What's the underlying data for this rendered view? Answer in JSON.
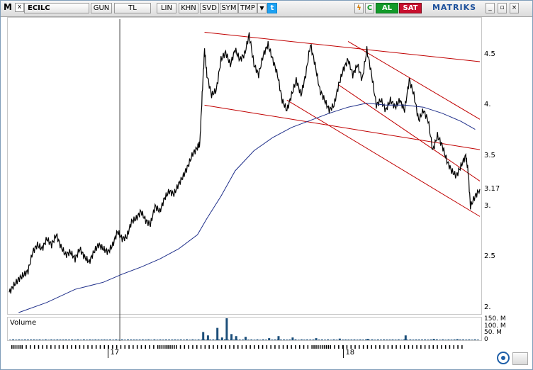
{
  "toolbar": {
    "logo": "M",
    "close_glyph": "x",
    "symbol": "ECILC",
    "period": "GUN",
    "currency": "TL",
    "scale": "LIN",
    "buttons": [
      "KHN",
      "SVD",
      "SYM",
      "TMP"
    ],
    "dropdown_glyph": "▼",
    "twitter_glyph": "t",
    "bolt_glyph": "ϟ",
    "refresh_glyph": "C",
    "buy_label": "AL",
    "sell_label": "SAT",
    "brand": "MATRIKS",
    "window_controls": [
      "_",
      "▫",
      "×"
    ]
  },
  "price_axis": {
    "ticks": [
      {
        "value": 4.5,
        "label": "4.5"
      },
      {
        "value": 4.0,
        "label": "4."
      },
      {
        "value": 3.5,
        "label": "3.5"
      },
      {
        "value": 3.17,
        "label": "3.17"
      },
      {
        "value": 3.0,
        "label": "3."
      },
      {
        "value": 2.5,
        "label": "2.5"
      },
      {
        "value": 2.0,
        "label": "2."
      }
    ],
    "last_price": 3.17
  },
  "volume_panel": {
    "title": "Volume",
    "ticks": [
      "150. M",
      "100. M",
      "50. M",
      "0"
    ]
  },
  "time_axis": {
    "labels": [
      "17",
      "18"
    ]
  },
  "colors": {
    "price_line": "#000000",
    "moving_average": "#1f2f8a",
    "trend_lines": "#c00000",
    "volume_bars": "#1d4f7a",
    "buy": "#139a2a",
    "sell": "#c8102e"
  },
  "chart_data": {
    "type": "line",
    "symbol": "ECILC",
    "ylim": [
      1.95,
      4.85
    ],
    "x_range": [
      0,
      1
    ],
    "series": [
      {
        "name": "",
        "values": [
          [
            0.0,
            2.15
          ],
          [
            0.01,
            2.22
          ],
          [
            0.02,
            2.28
          ],
          [
            0.03,
            2.32
          ],
          [
            0.04,
            2.36
          ],
          [
            0.05,
            2.55
          ],
          [
            0.06,
            2.62
          ],
          [
            0.07,
            2.58
          ],
          [
            0.08,
            2.68
          ],
          [
            0.09,
            2.62
          ],
          [
            0.1,
            2.72
          ],
          [
            0.11,
            2.6
          ],
          [
            0.12,
            2.52
          ],
          [
            0.13,
            2.55
          ],
          [
            0.14,
            2.48
          ],
          [
            0.15,
            2.58
          ],
          [
            0.16,
            2.5
          ],
          [
            0.17,
            2.45
          ],
          [
            0.18,
            2.55
          ],
          [
            0.19,
            2.62
          ],
          [
            0.2,
            2.58
          ],
          [
            0.21,
            2.55
          ],
          [
            0.22,
            2.62
          ],
          [
            0.23,
            2.75
          ],
          [
            0.24,
            2.68
          ],
          [
            0.25,
            2.7
          ],
          [
            0.26,
            2.85
          ],
          [
            0.27,
            2.88
          ],
          [
            0.28,
            2.95
          ],
          [
            0.29,
            2.86
          ],
          [
            0.3,
            2.82
          ],
          [
            0.31,
            3.0
          ],
          [
            0.32,
            2.95
          ],
          [
            0.33,
            3.08
          ],
          [
            0.34,
            3.15
          ],
          [
            0.35,
            3.12
          ],
          [
            0.36,
            3.22
          ],
          [
            0.37,
            3.3
          ],
          [
            0.38,
            3.4
          ],
          [
            0.39,
            3.52
          ],
          [
            0.4,
            3.58
          ],
          [
            0.405,
            3.62
          ],
          [
            0.41,
            4.1
          ],
          [
            0.415,
            4.55
          ],
          [
            0.42,
            4.3
          ],
          [
            0.43,
            4.1
          ],
          [
            0.44,
            4.15
          ],
          [
            0.45,
            4.45
          ],
          [
            0.46,
            4.52
          ],
          [
            0.47,
            4.4
          ],
          [
            0.48,
            4.55
          ],
          [
            0.49,
            4.45
          ],
          [
            0.5,
            4.5
          ],
          [
            0.51,
            4.7
          ],
          [
            0.52,
            4.4
          ],
          [
            0.53,
            4.3
          ],
          [
            0.54,
            4.5
          ],
          [
            0.55,
            4.6
          ],
          [
            0.56,
            4.45
          ],
          [
            0.57,
            4.3
          ],
          [
            0.58,
            4.05
          ],
          [
            0.59,
            3.95
          ],
          [
            0.6,
            4.1
          ],
          [
            0.61,
            4.25
          ],
          [
            0.62,
            4.1
          ],
          [
            0.63,
            4.3
          ],
          [
            0.64,
            4.6
          ],
          [
            0.65,
            4.4
          ],
          [
            0.66,
            4.15
          ],
          [
            0.67,
            4.05
          ],
          [
            0.68,
            3.95
          ],
          [
            0.69,
            4.0
          ],
          [
            0.7,
            4.2
          ],
          [
            0.71,
            4.35
          ],
          [
            0.72,
            4.45
          ],
          [
            0.73,
            4.3
          ],
          [
            0.74,
            4.4
          ],
          [
            0.75,
            4.25
          ],
          [
            0.76,
            4.55
          ],
          [
            0.77,
            4.3
          ],
          [
            0.78,
            4.0
          ],
          [
            0.79,
            4.05
          ],
          [
            0.8,
            3.95
          ],
          [
            0.81,
            4.05
          ],
          [
            0.82,
            3.98
          ],
          [
            0.83,
            4.05
          ],
          [
            0.84,
            3.95
          ],
          [
            0.85,
            4.25
          ],
          [
            0.86,
            4.1
          ],
          [
            0.87,
            3.85
          ],
          [
            0.88,
            3.95
          ],
          [
            0.89,
            3.85
          ],
          [
            0.9,
            3.55
          ],
          [
            0.91,
            3.7
          ],
          [
            0.92,
            3.6
          ],
          [
            0.93,
            3.45
          ],
          [
            0.94,
            3.35
          ],
          [
            0.95,
            3.3
          ],
          [
            0.96,
            3.4
          ],
          [
            0.97,
            3.5
          ],
          [
            0.975,
            3.35
          ],
          [
            0.98,
            3.0
          ],
          [
            0.99,
            3.1
          ],
          [
            1.0,
            3.17
          ]
        ]
      },
      {
        "name": "",
        "values": [
          [
            0.02,
            1.95
          ],
          [
            0.08,
            2.05
          ],
          [
            0.14,
            2.18
          ],
          [
            0.2,
            2.25
          ],
          [
            0.24,
            2.33
          ],
          [
            0.28,
            2.4
          ],
          [
            0.32,
            2.48
          ],
          [
            0.36,
            2.58
          ],
          [
            0.4,
            2.72
          ],
          [
            0.42,
            2.88
          ],
          [
            0.45,
            3.1
          ],
          [
            0.48,
            3.35
          ],
          [
            0.52,
            3.55
          ],
          [
            0.56,
            3.68
          ],
          [
            0.6,
            3.78
          ],
          [
            0.64,
            3.85
          ],
          [
            0.68,
            3.92
          ],
          [
            0.72,
            3.98
          ],
          [
            0.76,
            4.02
          ],
          [
            0.8,
            4.0
          ],
          [
            0.84,
            4.0
          ],
          [
            0.88,
            3.98
          ],
          [
            0.92,
            3.92
          ],
          [
            0.96,
            3.84
          ],
          [
            0.99,
            3.76
          ]
        ]
      }
    ],
    "trend_lines": [
      {
        "from": [
          0.415,
          4.72
        ],
        "to": [
          1.0,
          4.43
        ]
      },
      {
        "from": [
          0.415,
          4.0
        ],
        "to": [
          1.0,
          3.56
        ]
      },
      {
        "from": [
          0.72,
          4.63
        ],
        "to": [
          1.0,
          3.86
        ]
      },
      {
        "from": [
          0.59,
          4.05
        ],
        "to": [
          1.0,
          2.9
        ]
      },
      {
        "from": [
          0.7,
          4.2
        ],
        "to": [
          1.0,
          3.25
        ]
      }
    ],
    "cursor_x": 0.235,
    "volume": {
      "unit": "M",
      "ylim": [
        0,
        160
      ],
      "bars": [
        [
          0.41,
          60
        ],
        [
          0.42,
          35
        ],
        [
          0.44,
          90
        ],
        [
          0.45,
          20
        ],
        [
          0.46,
          170
        ],
        [
          0.47,
          45
        ],
        [
          0.48,
          30
        ],
        [
          0.5,
          25
        ],
        [
          0.55,
          15
        ],
        [
          0.57,
          30
        ],
        [
          0.6,
          20
        ],
        [
          0.65,
          15
        ],
        [
          0.7,
          12
        ],
        [
          0.76,
          10
        ],
        [
          0.84,
          35
        ],
        [
          0.9,
          10
        ],
        [
          0.95,
          8
        ]
      ],
      "baseline_level": 6
    }
  }
}
